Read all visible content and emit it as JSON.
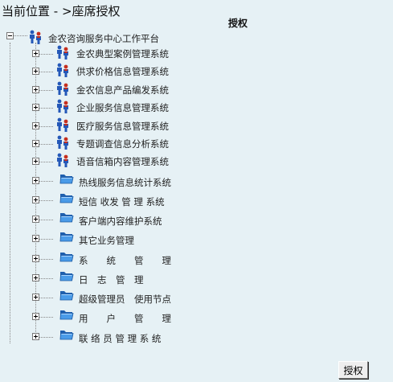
{
  "breadcrumb": "当前位置 - >座席授权",
  "panel_title": "授权",
  "tree": {
    "root": {
      "label": "金农咨询服务中心工作平台",
      "icon": "people-icon",
      "expanded": true
    },
    "children": [
      {
        "label": "金农典型案例管理系统",
        "icon": "people-icon"
      },
      {
        "label": "供求价格信息管理系统",
        "icon": "people-icon"
      },
      {
        "label": "金农信息产品编发系统",
        "icon": "people-icon"
      },
      {
        "label": "企业服务信息管理系统",
        "icon": "people-icon"
      },
      {
        "label": "医疗服务信息管理系统",
        "icon": "people-icon"
      },
      {
        "label": "专题调查信息分析系统",
        "icon": "people-icon"
      },
      {
        "label": "语音信箱内容管理系统",
        "icon": "people-icon"
      },
      {
        "label": "热线服务信息统计系统",
        "icon": "folder-icon"
      },
      {
        "label": "短信 收发 管 理 系统",
        "icon": "folder-icon"
      },
      {
        "label": "客户端内容维护系统",
        "icon": "folder-icon"
      },
      {
        "label": "其它业务管理",
        "icon": "folder-icon"
      },
      {
        "label": "系　　统　　管　　理",
        "icon": "folder-icon"
      },
      {
        "label": "日　志　管　理",
        "icon": "folder-icon"
      },
      {
        "label": "超级管理员　使用节点",
        "icon": "folder-icon"
      },
      {
        "label": "用　　户　　管　　理",
        "icon": "folder-icon"
      },
      {
        "label": "联 络 员 管 理 系 统",
        "icon": "folder-icon"
      }
    ]
  },
  "submit_button": "授权",
  "colors": {
    "background": "#e6f1f5",
    "folder": "#2f7fd6",
    "people_blue": "#2458b8",
    "people_red": "#c62f1f"
  }
}
